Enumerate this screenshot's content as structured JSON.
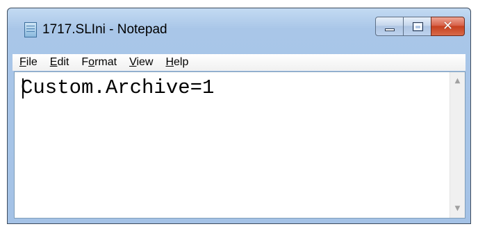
{
  "window": {
    "title": "1717.SLIni - Notepad"
  },
  "menu": {
    "items": [
      {
        "label_ul": "F",
        "label_rest": "ile"
      },
      {
        "label_ul": "E",
        "label_rest": "dit"
      },
      {
        "label_pre": "F",
        "label_ul": "o",
        "label_rest": "rmat"
      },
      {
        "label_ul": "V",
        "label_rest": "iew"
      },
      {
        "label_ul": "H",
        "label_rest": "elp"
      }
    ]
  },
  "editor": {
    "content": "Custom.Archive=1"
  },
  "caption_buttons": {
    "close_glyph": "✕"
  },
  "scrollbar": {
    "up_glyph": "▲",
    "down_glyph": "▼"
  },
  "icons": {
    "app": "notepad-icon",
    "minimize": "minimize-icon",
    "maximize": "maximize-icon",
    "close": "close-icon"
  }
}
